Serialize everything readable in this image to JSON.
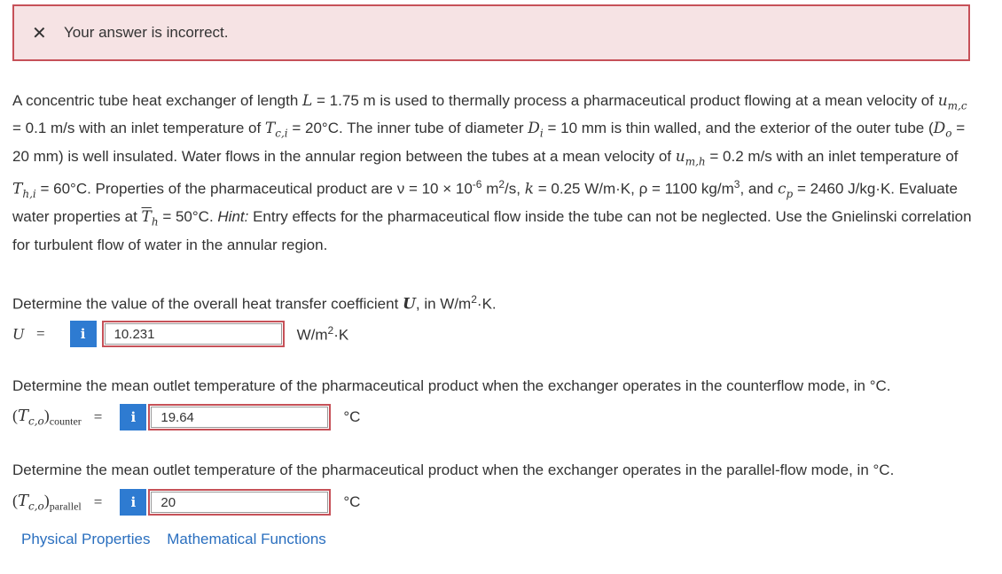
{
  "alert": {
    "icon": "close-icon",
    "message": "Your answer is incorrect."
  },
  "problem": {
    "p1": "A concentric tube heat exchanger of length ",
    "L_sym": "L",
    "p2": " = 1.75 m is used to thermally process a pharmaceutical product flowing at a mean velocity of ",
    "umc": "u",
    "umc_sub": "m,c",
    "p3": " = 0.1 m/s with an inlet temperature of ",
    "Tci": "T",
    "Tci_sub": "c,i",
    "p4": " = 20°C. The inner tube of diameter ",
    "Di": "D",
    "Di_sub": "i",
    "p5": " = 10 mm is thin walled, and the exterior of the outer tube (",
    "Do": "D",
    "Do_sub": "o",
    "p6": " = 20 mm) is well insulated. Water flows in the annular region between the tubes at a mean velocity of ",
    "umh": "u",
    "umh_sub": "m,h",
    "p7": " = 0.2 m/s with an inlet temperature of ",
    "Thi": "T",
    "Thi_sub": "h,i",
    "p8": " = 60°C. Properties of the pharmaceutical product are ν = 10 × 10",
    "p8_sup": "-6",
    "p9": " m",
    "p9_sup": "2",
    "p10": "/s, ",
    "k_sym": "k",
    "p11": " = 0.25 W/m·K, ρ = 1100 kg/m",
    "p11_sup": "3",
    "p12": ", and ",
    "cp": "c",
    "cp_sub": "p",
    "p13": " = 2460 J/kg·K. Evaluate water properties at ",
    "Th": "T",
    "Th_sub": "h",
    "p14": " = 50°C. ",
    "hint": "Hint:",
    "p15": " Entry effects for the pharmaceutical flow inside the tube can not be neglected. Use the Gnielinski correlation for turbulent flow of water in the annular region."
  },
  "q1": {
    "text_a": "Determine the value of the overall heat transfer coefficient ",
    "sym": "U",
    "text_b": ", in W/m",
    "text_sup": "2",
    "text_c": "·K.",
    "label": "U",
    "eq": "=",
    "info": "i",
    "value": "10.231",
    "unit_a": "W/m",
    "unit_sup": "2",
    "unit_b": "·K"
  },
  "q2": {
    "text": "Determine the mean outlet temperature of the pharmaceutical product when the exchanger operates in the counterflow mode, in °C.",
    "label_T": "T",
    "label_sub": "c,o",
    "label_mode": "counter",
    "eq": "=",
    "info": "i",
    "value": "19.64",
    "unit": "°C"
  },
  "q3": {
    "text": "Determine the mean outlet temperature of the pharmaceutical product when the exchanger operates in the parallel-flow mode, in °C.",
    "label_T": "T",
    "label_sub": "c,o",
    "label_mode": "parallel",
    "eq": "=",
    "info": "i",
    "value": "20",
    "unit": "°C"
  },
  "links": {
    "physical": "Physical Properties",
    "math": "Mathematical Functions"
  },
  "colors": {
    "alert_bg": "#f6e3e4",
    "alert_border": "#c65158",
    "info_btn": "#2e7bd1",
    "link": "#2a6fbf"
  }
}
